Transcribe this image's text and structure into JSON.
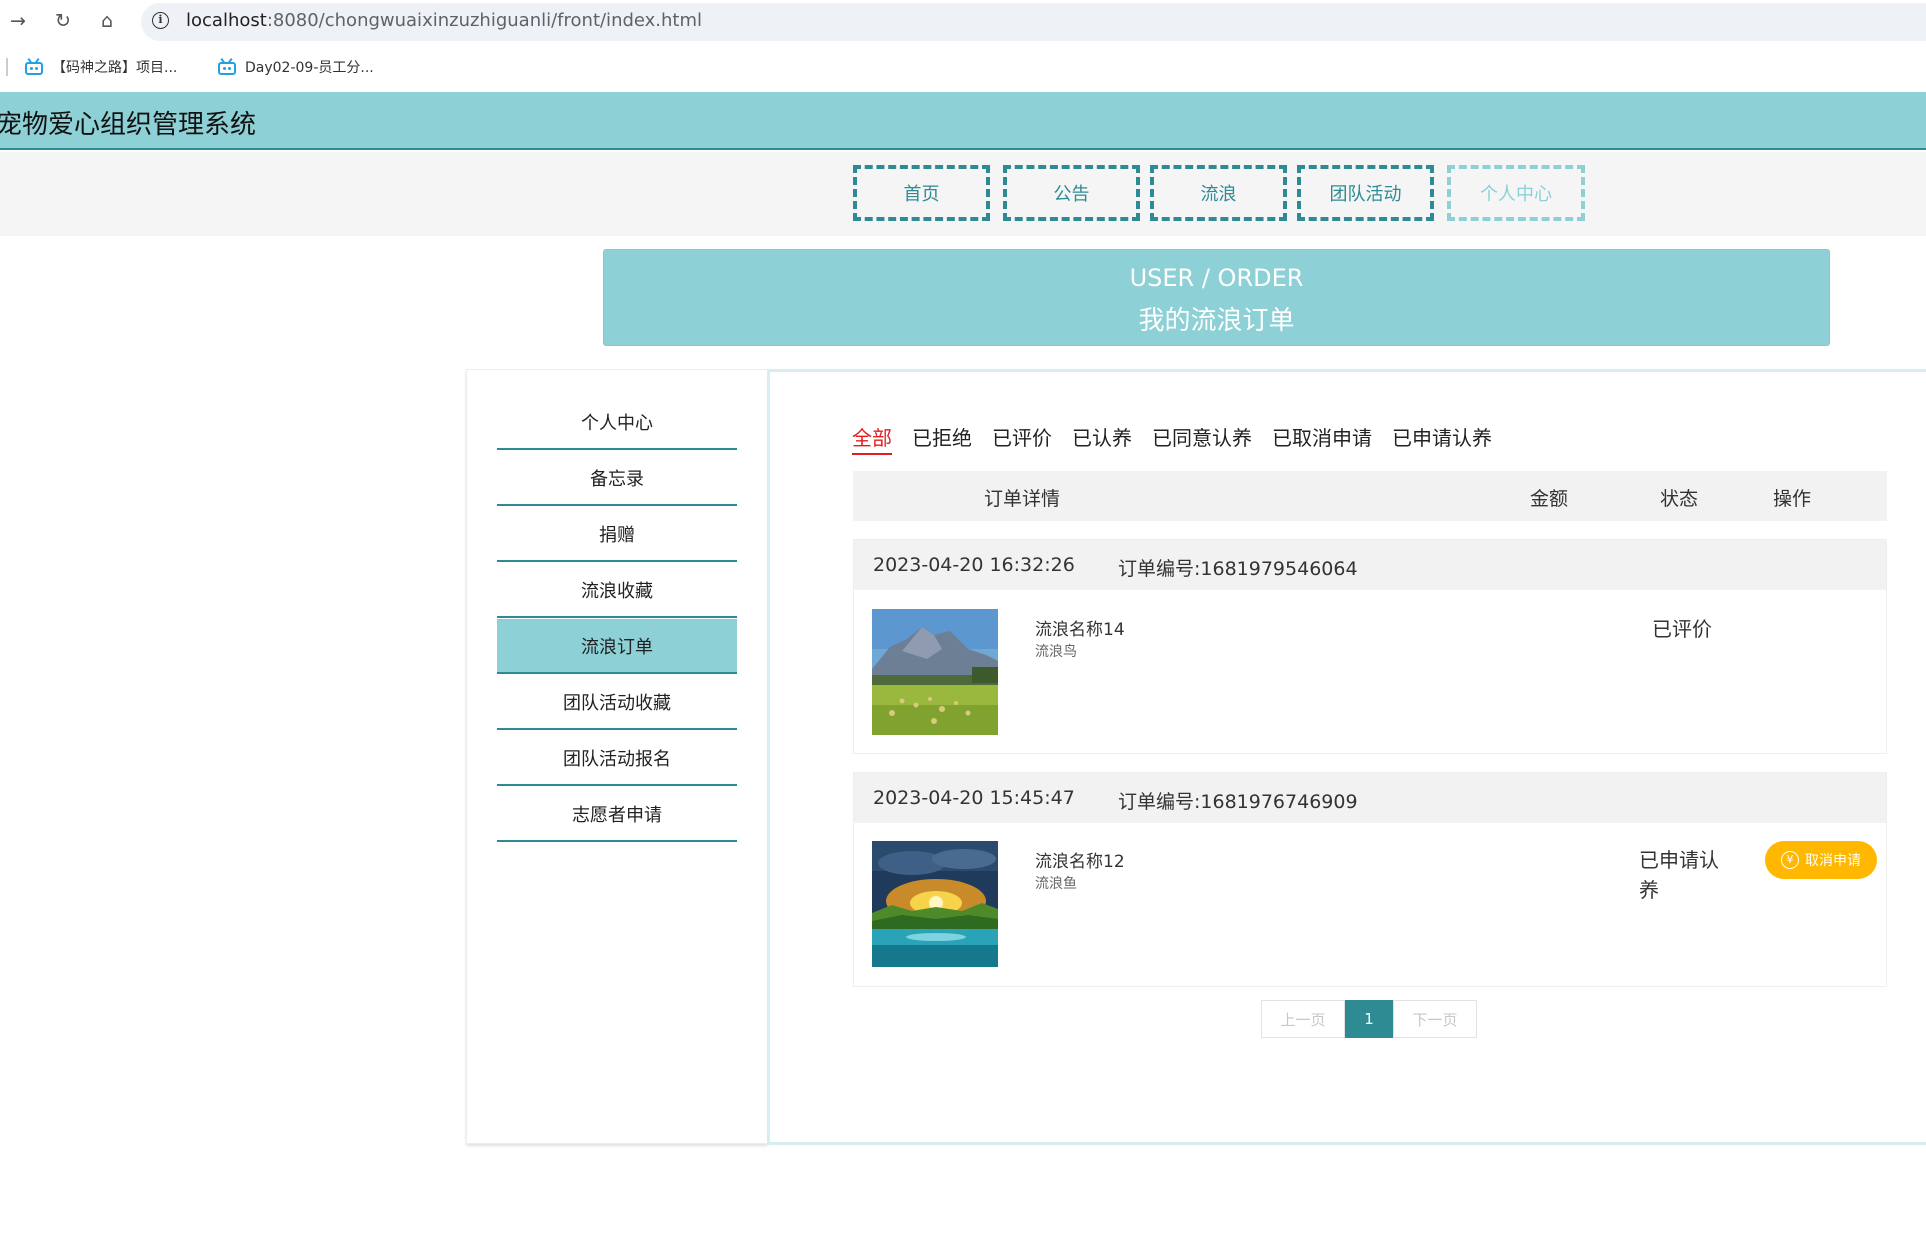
{
  "browser": {
    "url_host": "localhost",
    "url_rest": ":8080/chongwuaixinzuzhiguanli/front/index.html",
    "bookmarks": [
      {
        "label": "【码神之路】项目..."
      },
      {
        "label": "Day02-09-员工分..."
      }
    ]
  },
  "app": {
    "title": "宠物爱心组织管理系统",
    "nav": [
      "首页",
      "公告",
      "流浪",
      "团队活动",
      "个人中心"
    ]
  },
  "banner": {
    "en": "USER / ORDER",
    "zh": "我的流浪订单"
  },
  "sidebar": {
    "items": [
      "个人中心",
      "备忘录",
      "捐赠",
      "流浪收藏",
      "流浪订单",
      "团队活动收藏",
      "团队活动报名",
      "志愿者申请"
    ]
  },
  "tabs": [
    "全部",
    "已拒绝",
    "已评价",
    "已认养",
    "已同意认养",
    "已取消申请",
    "已申请认养"
  ],
  "table": {
    "headers": {
      "detail": "订单详情",
      "amount": "金额",
      "status": "状态",
      "action": "操作"
    }
  },
  "orders": [
    {
      "time": "2023-04-20 16:32:26",
      "order_no": "订单编号:1681979546064",
      "name": "流浪名称14",
      "type": "流浪鸟",
      "status": "已评价",
      "action": "",
      "image": "mountain-meadow"
    },
    {
      "time": "2023-04-20 15:45:47",
      "order_no": "订单编号:1681976746909",
      "name": "流浪名称12",
      "type": "流浪鱼",
      "status": "已申请认养",
      "action": "取消申请",
      "image": "sunset-lake"
    }
  ],
  "pager": {
    "prev": "上一页",
    "current": "1",
    "next": "下一页"
  },
  "colors": {
    "primary": "#2e8b93",
    "light": "#8dd0d6",
    "accent": "#ffb700",
    "active_tab": "#e02020"
  }
}
